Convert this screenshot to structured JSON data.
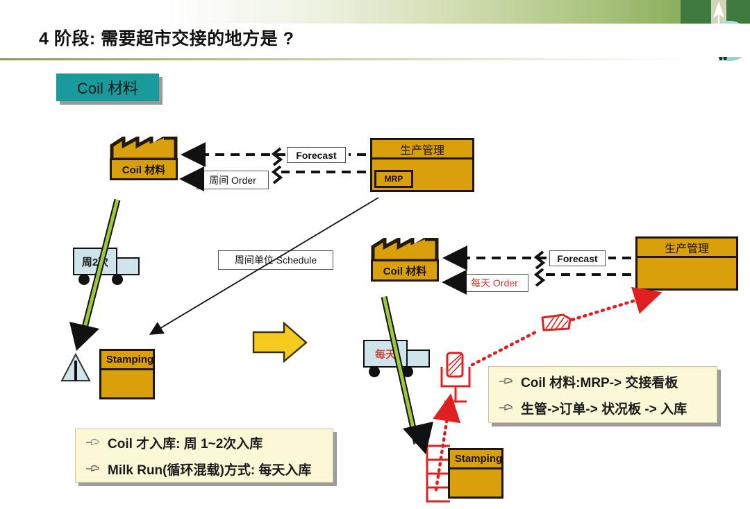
{
  "slide": {
    "title": "4 阶段: 需要超市交接的地方是 ?",
    "section_tag": "Coil 材料"
  },
  "colors": {
    "header_green": "#6d9c44",
    "tag_teal": "#1a9a9a",
    "factory_gold": "#d9a00c",
    "truck_blue": "#cfe4ea",
    "arrow_yellow": "#f6c91d",
    "kanban_red": "#e02020",
    "note_cream": "#fbf8d8",
    "green_flow": "#9dc83c"
  },
  "left_diagram": {
    "supplier_factory_label": "Coil 材料",
    "forecast_label": "Forecast",
    "order_label": "周间 Order",
    "control_box_title": "生产管理",
    "control_box_mrp": "MRP",
    "truck_label": "周2次",
    "schedule_label": "周间单位 Schedule",
    "process_label": "Stamping"
  },
  "right_diagram": {
    "supplier_factory_label": "Coil 材料",
    "forecast_label": "Forecast",
    "order_label": "每天 Order",
    "control_box_title": "生产管理",
    "truck_label": "每天",
    "process_label": "Stamping"
  },
  "transition_arrow": {
    "icon": "right-arrow-icon"
  },
  "note_left": {
    "bullet_icon": "pointing-hand-icon",
    "lines": [
      "Coil 才入库: 周 1~2次入库",
      "Milk Run(循环混载)方式: 每天入库"
    ]
  },
  "note_right": {
    "bullet_icon": "pointing-hand-icon",
    "lines": [
      "Coil 材料:MRP-> 交接看板",
      "生管->订单-> 状况板 -> 入库"
    ]
  },
  "icons": {
    "inventory_triangle": "inventory-triangle-icon",
    "kanban_card": "kanban-card-icon",
    "kanban_post": "kanban-post-icon",
    "supermarket": "supermarket-shelf-icon",
    "logo": "handshake-logo-icon"
  }
}
